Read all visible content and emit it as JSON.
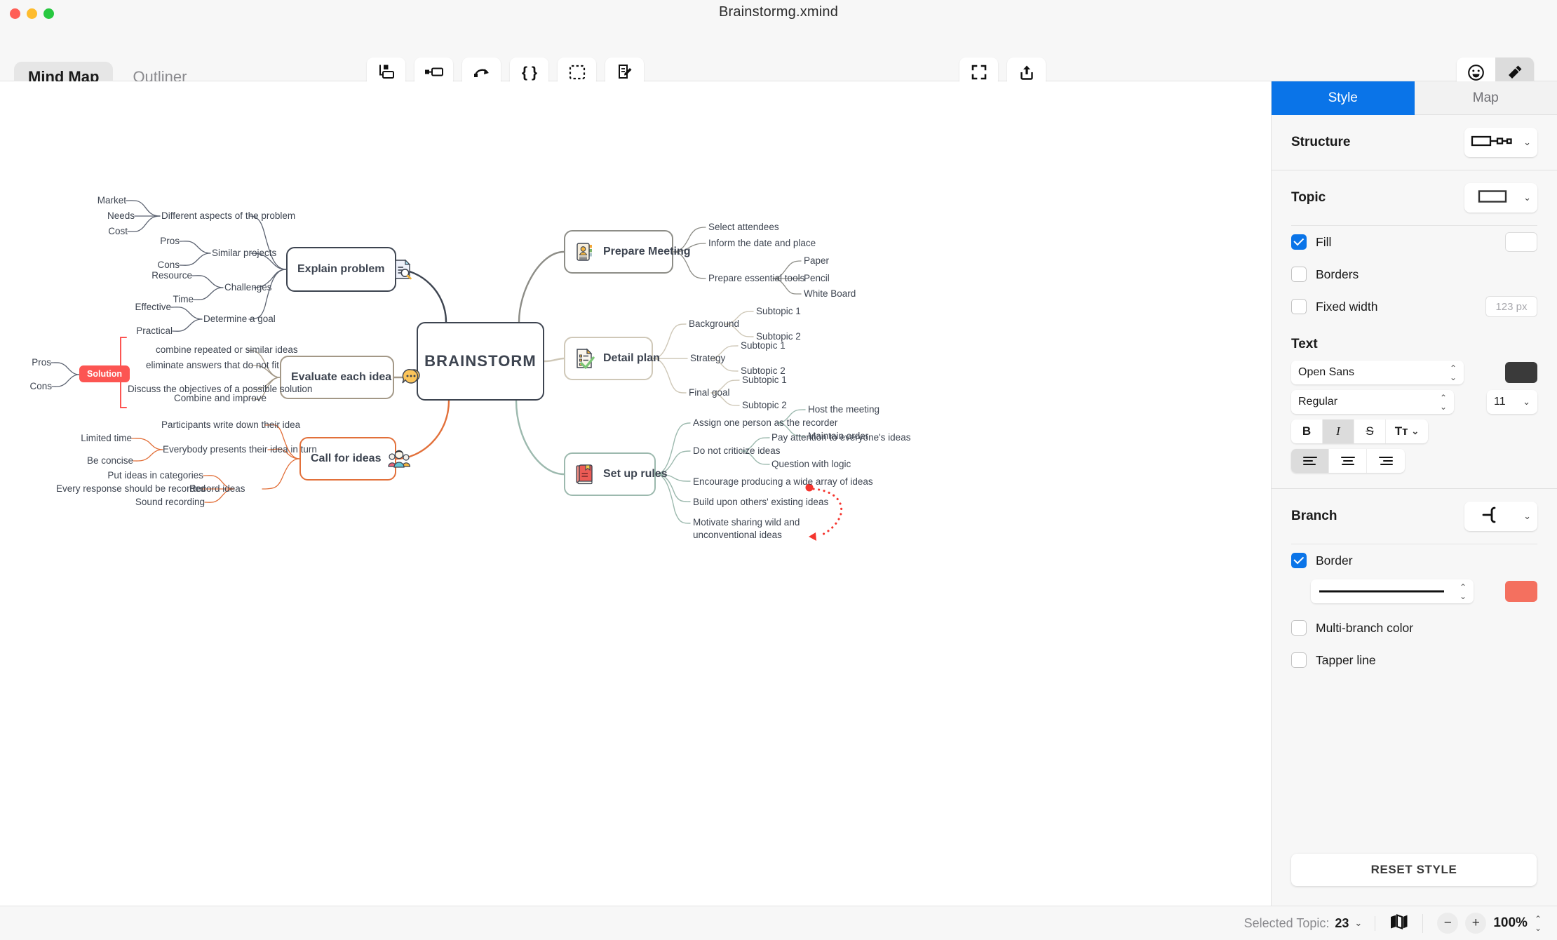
{
  "window": {
    "title": "Brainstormg.xmind"
  },
  "modes": {
    "mindmap": "Mind Map",
    "outliner": "Outliner"
  },
  "toolbar": {
    "center": [
      {
        "label": "Topic",
        "icon": "topic-icon"
      },
      {
        "label": "Subtopic",
        "icon": "subtopic-icon"
      },
      {
        "label": "Relationship",
        "icon": "relationship-icon"
      },
      {
        "label": "Summary",
        "icon": "summary-icon"
      },
      {
        "label": "Boundary",
        "icon": "boundary-icon"
      },
      {
        "label": "Note",
        "icon": "note-icon"
      }
    ],
    "right": [
      {
        "label": "Zen",
        "icon": "zen-icon"
      },
      {
        "label": "share",
        "icon": "share-icon"
      }
    ],
    "segmented": [
      {
        "label": "Icon",
        "icon": "smiley-icon",
        "active": false
      },
      {
        "label": "Format",
        "icon": "brush-icon",
        "active": true
      }
    ]
  },
  "map": {
    "central": "BRAINSTORM",
    "branches": [
      {
        "title": "Explain problem",
        "icon": "document-search-icon",
        "side": "left",
        "color": "#3d4450",
        "children": [
          {
            "label": "Different aspects of the problem",
            "children": [
              "Market",
              "Needs",
              "Cost"
            ]
          },
          {
            "label": "Similar projects",
            "children": [
              "Pros",
              "Cons"
            ]
          },
          {
            "label": "Challenges",
            "children": [
              "Resource",
              "Time"
            ]
          },
          {
            "label": "Determine a goal",
            "children": [
              "Effective",
              "Practical"
            ]
          }
        ]
      },
      {
        "title": "Evaluate each idea",
        "icon": "speech-bubbles-icon",
        "side": "left",
        "color": "#a39887",
        "summary": {
          "label": "Solution",
          "children": [
            "Pros",
            "Cons"
          ]
        },
        "children": [
          {
            "label": "combine repeated or similar ideas",
            "children": []
          },
          {
            "label": "eliminate answers that do not fit",
            "children": []
          },
          {
            "label": "Discuss the objectives of a possible solution",
            "children": []
          },
          {
            "label": "Combine and improve",
            "children": []
          }
        ]
      },
      {
        "title": "Call for ideas",
        "icon": "people-group-icon",
        "side": "left",
        "color": "#e2703a",
        "children": [
          {
            "label": "Participants write down their idea",
            "children": []
          },
          {
            "label": "Everybody presents their idea in turn",
            "children": [
              "Limited time",
              "Be concise"
            ]
          },
          {
            "label": "Record ideas",
            "children": [
              "Put ideas in categories",
              "Every response should be recorded",
              "Sound recording"
            ]
          }
        ]
      },
      {
        "title": "Prepare Meeting",
        "icon": "contact-card-icon",
        "side": "right",
        "color": "#8d8d87",
        "children": [
          {
            "label": "Select attendees",
            "children": []
          },
          {
            "label": "Inform the date and place",
            "children": []
          },
          {
            "label": "Prepare essential tools",
            "children": [
              "Paper",
              "Pencil",
              "White Board"
            ]
          }
        ]
      },
      {
        "title": "Detail plan",
        "icon": "checklist-icon",
        "side": "right",
        "color": "#cfc8b8",
        "children": [
          {
            "label": "Background",
            "children": [
              "Subtopic 1",
              "Subtopic 2"
            ]
          },
          {
            "label": "Strategy",
            "children": [
              "Subtopic 1",
              "Subtopic 2"
            ]
          },
          {
            "label": "Final goal",
            "children": [
              "Subtopic 1",
              "Subtopic 2"
            ]
          }
        ]
      },
      {
        "title": "Set up rules",
        "icon": "red-book-icon",
        "side": "right",
        "color": "#9cb9ae",
        "children": [
          {
            "label": "Assign one person as the recorder",
            "children": [
              "Host the meeting",
              "Maintain order"
            ]
          },
          {
            "label": "Do not criticize ideas",
            "children": [
              "Pay attention to everyone's ideas",
              "Question with logic"
            ]
          },
          {
            "label": "Encourage producing a wide array of ideas",
            "children": []
          },
          {
            "label": "Build upon others' existing ideas",
            "children": []
          },
          {
            "label": "Motivate sharing wild and unconventional ideas",
            "children": []
          }
        ]
      }
    ],
    "relationship": {
      "from": "Encourage producing a wide array of ideas",
      "to": "Motivate sharing wild and unconventional ideas",
      "color": "#f5352e",
      "style": "dotted-arrow"
    }
  },
  "panel": {
    "tabs": [
      {
        "label": "Style",
        "active": true
      },
      {
        "label": "Map",
        "active": false
      }
    ],
    "structure": {
      "label": "Structure",
      "icon": "logic-right-structure-icon"
    },
    "topic": {
      "label": "Topic",
      "icon": "rectangle-shape-icon"
    },
    "fill": {
      "label": "Fill",
      "checked": true,
      "color": "#ffffff"
    },
    "borders": {
      "label": "Borders",
      "checked": false
    },
    "fixed_width": {
      "label": "Fixed width",
      "checked": false,
      "value": "123 px"
    },
    "text": {
      "label": "Text",
      "font_family": "Open Sans",
      "font_weight": "Regular",
      "font_size": "11",
      "color": "#3a3a3a",
      "bold": {
        "label": "B",
        "on": false
      },
      "italic": {
        "label": "I",
        "on": true
      },
      "strike": {
        "label": "S",
        "on": false
      },
      "case": {
        "label": "Tᴛ",
        "on": false
      },
      "align": "left"
    },
    "branch": {
      "label": "Branch",
      "icon": "branch-shape-icon"
    },
    "border": {
      "label": "Border",
      "checked": true,
      "color": "#f4705f",
      "line": "solid"
    },
    "multi_branch_color": {
      "label": "Multi-branch color",
      "checked": false
    },
    "tapper_line": {
      "label": "Tapper line",
      "checked": false
    },
    "reset": "RESET STYLE"
  },
  "status": {
    "selected_label": "Selected Topic:",
    "selected_count": "23",
    "map_icon": "map-icon",
    "zoom_out": "−",
    "zoom_in": "+",
    "zoom_value": "100%"
  }
}
